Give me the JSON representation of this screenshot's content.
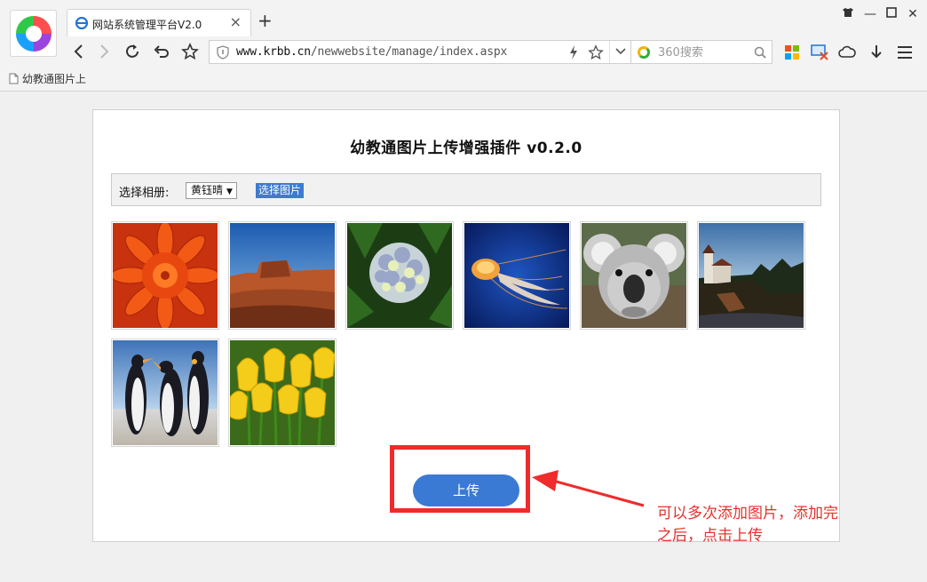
{
  "browser": {
    "tab_title": "网站系统管理平台V2.0",
    "url_domain": "www.krbb.cn",
    "url_path": "/newwebsite/manage/index.aspx",
    "search_placeholder": "360搜索",
    "bookmark_label": "幼教通图片上"
  },
  "page": {
    "title": "幼教通图片上传增强插件 v0.2.0",
    "album_label": "选择相册:",
    "album_selected": "黄钰晴",
    "choose_button": "选择图片",
    "upload_button": "上传"
  },
  "annotation": {
    "line1": "可以多次添加图片，添加完",
    "line2": "之后，点击上传",
    "color": "#e5322d"
  },
  "photos": [
    "chrysanthemum",
    "desert",
    "hydrangeas",
    "jellyfish",
    "koala",
    "lighthouse",
    "penguins",
    "tulips"
  ],
  "colors": {
    "accent": "#3a7ad4",
    "highlight": "#ef2b2b"
  }
}
